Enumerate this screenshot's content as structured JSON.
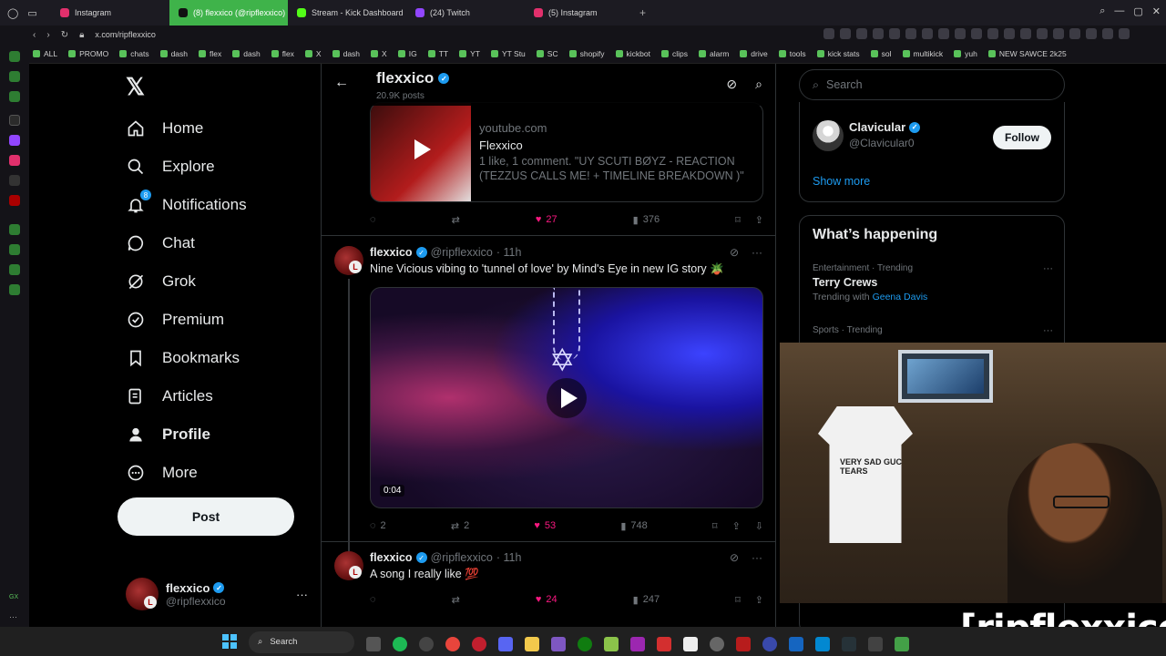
{
  "browser": {
    "tabs": [
      {
        "label": "Instagram",
        "color": "#e1306c"
      },
      {
        "label": "(8) flexxico (@ripflexxico)",
        "color": "#000000",
        "active": true
      },
      {
        "label": "Stream - Kick Dashboard",
        "color": "#53fc18"
      },
      {
        "label": "(24) Twitch",
        "color": "#9146ff"
      },
      {
        "label": "(5) Instagram",
        "color": "#e1306c"
      }
    ],
    "url": "x.com/ripflexxico",
    "bookmarks": [
      "ALL",
      "PROMO",
      "chats",
      "dash",
      "flex",
      "dash",
      "flex",
      "X",
      "dash",
      "X",
      "IG",
      "TT",
      "YT",
      "YT Stu",
      "SC",
      "shopify",
      "kickbot",
      "clips",
      "alarm",
      "drive",
      "tools",
      "kick stats",
      "sol",
      "multikick",
      "yuh",
      "NEW SAWCE 2k25"
    ]
  },
  "nav": {
    "items": [
      {
        "label": "Home",
        "icon": "home-icon"
      },
      {
        "label": "Explore",
        "icon": "search-icon"
      },
      {
        "label": "Notifications",
        "icon": "bell-icon",
        "badge": "8"
      },
      {
        "label": "Chat",
        "icon": "chat-icon"
      },
      {
        "label": "Grok",
        "icon": "grok-icon"
      },
      {
        "label": "Premium",
        "icon": "premium-icon"
      },
      {
        "label": "Bookmarks",
        "icon": "bookmark-icon"
      },
      {
        "label": "Articles",
        "icon": "articles-icon"
      },
      {
        "label": "Profile",
        "icon": "profile-icon"
      },
      {
        "label": "More",
        "icon": "more-icon"
      }
    ],
    "post_label": "Post",
    "account": {
      "name": "flexxico",
      "handle": "@ripflexxico"
    }
  },
  "header": {
    "title": "flexxico",
    "posts": "20.9K posts"
  },
  "link_card": {
    "domain": "youtube.com",
    "title": "Flexxico",
    "description": "1 like, 1 comment. \"UY SCUTI BØYZ - REACTION (TEZZUS CALLS ME! + TIMELINE BREAKDOWN )\"",
    "likes": "27",
    "views": "376"
  },
  "tweets": [
    {
      "name": "flexxico",
      "handle": "@ripflexxico",
      "time": "· 11h",
      "text": "Nine Vicious vibing to 'tunnel of love' by Mind's Eye in new IG story 🪴",
      "video_time": "0:04",
      "replies": "2",
      "reposts": "2",
      "likes": "53",
      "views": "748"
    },
    {
      "name": "flexxico",
      "handle": "@ripflexxico",
      "time": "· 11h",
      "text": "A song I really like 💯",
      "likes": "24",
      "views": "247"
    }
  ],
  "sidebar": {
    "search_placeholder": "Search",
    "who_to_follow": {
      "name": "Clavicular",
      "handle": "@Clavicular0",
      "follow_label": "Follow",
      "show_more": "Show more"
    },
    "trending_title": "What’s happening",
    "trends": [
      {
        "category": "Entertainment · Trending",
        "title": "Terry Crews",
        "with_prefix": "Trending with",
        "with": "Geena Davis"
      },
      {
        "category": "Sports · Trending",
        "title": ""
      }
    ]
  },
  "webcam": {
    "shirt_text": "VERY SAD GUCCI TEARS"
  },
  "overlay": {
    "handle": "[ripflexxico]"
  },
  "taskbar": {
    "search_label": "Search"
  },
  "colors": {
    "accent": "#1d9bf0",
    "like": "#f91880",
    "background": "#000000"
  }
}
